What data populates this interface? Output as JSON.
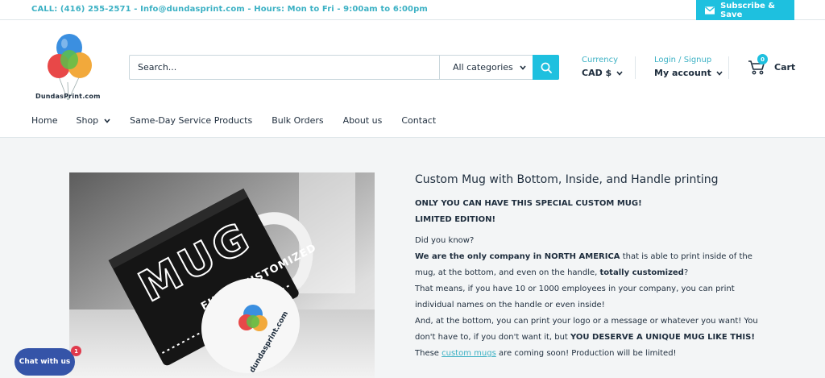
{
  "topbar": {
    "contact": "CALL: (416) 255-2571 - Info@dundasprint.com - Hours: Mon to Fri - 9:00am to 6:00pm",
    "subscribe_label": "Subscribe & Save",
    "subscribe_icon": "envelope-icon"
  },
  "header": {
    "logo_text": "DundasPrint.com",
    "search": {
      "placeholder": "Search...",
      "category": "All categories"
    },
    "currency": {
      "label": "Currency",
      "value": "CAD $"
    },
    "account": {
      "label": "Login / Signup",
      "value": "My account"
    },
    "cart": {
      "count": "0",
      "label": "Cart"
    }
  },
  "nav": {
    "items": [
      {
        "label": "Home"
      },
      {
        "label": "Shop"
      },
      {
        "label": "Same-Day Service Products"
      },
      {
        "label": "Bulk Orders"
      },
      {
        "label": "About us"
      },
      {
        "label": "Contact"
      }
    ]
  },
  "product": {
    "mug_text": "MUG",
    "mug_subtext": "FULLY CUSTOMIZED",
    "mug_brand": "dundasprint.com",
    "title": "Custom Mug with Bottom, Inside, and Handle printing",
    "line1": "ONLY YOU CAN HAVE THIS SPECIAL CUSTOM MUG!",
    "line2": "LIMITED EDITION!",
    "line3": "Did you know?",
    "line4_strong": "We are the only company in NORTH AMERICA",
    "line4_rest": " that is able to print inside of the mug, at the bottom, and even on the handle, ",
    "line4_strong2": "totally customized",
    "line4_end": "?",
    "line5": "That means, if you have 10 or 1000 employees in your company, you can print individual names on the handle or even inside!",
    "line6_start": "And, at the bottom, you can print your logo or a message or whatever you want! You don't have to, if you don't want it, but ",
    "line6_strong": "YOU DESERVE A UNIQUE MUG LIKE THIS!",
    "line7_start": "These ",
    "line7_link": "custom mugs",
    "line7_end": " are coming soon! Production will be limited!"
  },
  "chat": {
    "label": "Chat with us",
    "badge": "1"
  },
  "colors": {
    "accent": "#1ec0df",
    "text": "#1e2d3d",
    "link": "#3cb1c4",
    "chat": "#3554a8",
    "badge": "#e03a4c"
  }
}
